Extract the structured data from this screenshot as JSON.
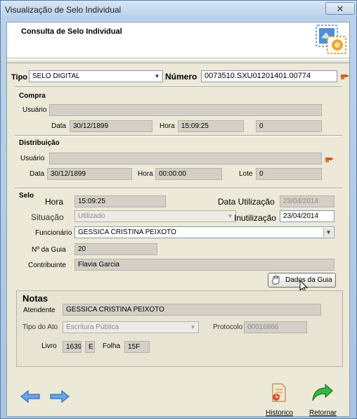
{
  "window": {
    "title": "Visualização de Selo Individual",
    "close_glyph": "✕"
  },
  "header": {
    "title": "Consulta de Selo Individual",
    "icon": "stamp-icon"
  },
  "top": {
    "tipo_label": "Tipo",
    "tipo_value": "SELO DIGITAL",
    "numero_label": "Número",
    "numero_value": "0073510.SXU01201401.00774"
  },
  "compra": {
    "title": "Compra",
    "usuario_label": "Usuário",
    "usuario_value": "",
    "data_label": "Data",
    "data_value": "30/12/1899",
    "hora_label": "Hora",
    "hora_value": "15:09:25",
    "extra_value": "0"
  },
  "distribuicao": {
    "title": "Distribuição",
    "usuario_label": "Usuário",
    "usuario_value": "",
    "data_label": "Data",
    "data_value": "30/12/1899",
    "hora_label": "Hora",
    "hora_value": "00:00:00",
    "lote_label": "Lote",
    "lote_value": "0"
  },
  "selo": {
    "title": "Selo",
    "hora_label": "Hora",
    "hora_value": "15:09:25",
    "data_utilizacao_label": "Data Utilização",
    "data_utilizacao_value": "23/04/2014",
    "situacao_label": "Situação",
    "situacao_value": "Utilizado",
    "inutilizacao_label": "Inutilização",
    "inutilizacao_value": "23/04/2014",
    "funcionario_label": "Funcionário",
    "funcionario_value": "GESSICA CRISTINA PEIXOTO",
    "guia_label": "Nº da Guia",
    "guia_value": "20",
    "contribuinte_label": "Contribuinte",
    "contribuinte_value": "Flavia Garcia",
    "dados_guia_button": "Dados da Guia"
  },
  "notas": {
    "title": "Notas",
    "atendente_label": "Atendente",
    "atendente_value": "GESSICA CRISTINA PEIXOTO",
    "tipo_ato_label": "Tipo do Ato",
    "tipo_ato_value": "Escritura Pública",
    "protocolo_label": "Protocolo",
    "protocolo_value": "00016866",
    "livro_label": "Livro",
    "livro_value": "1639",
    "livro_suffix": "E",
    "folha_label": "Folha",
    "folha_value": "15F"
  },
  "footer": {
    "historico_label": "Historico",
    "retornar_label": "Retornar"
  },
  "colors": {
    "accent": "#3d7fd6",
    "green": "#2fa63a",
    "finger": "#d4581f"
  }
}
